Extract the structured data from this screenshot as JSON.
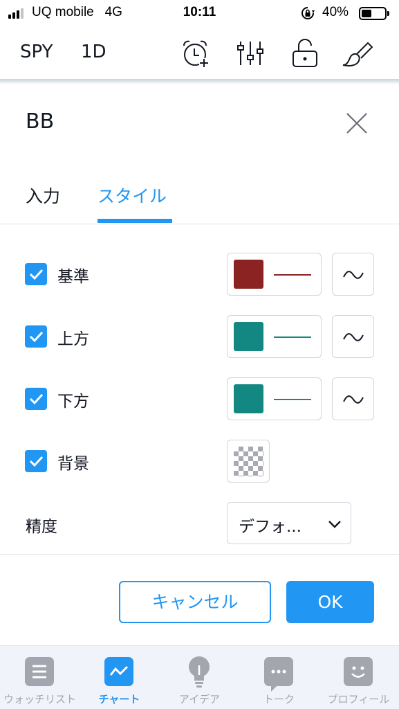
{
  "status_bar": {
    "carrier": "UQ mobile",
    "network": "4G",
    "time": "10:11",
    "battery": "40%"
  },
  "toolbar": {
    "symbol": "SPY",
    "interval": "1D"
  },
  "dialog": {
    "title": "BB",
    "tabs": [
      {
        "label": "入力",
        "active": false
      },
      {
        "label": "スタイル",
        "active": true
      }
    ],
    "rows": [
      {
        "label": "基準",
        "checked": true,
        "color": "#8b2323"
      },
      {
        "label": "上方",
        "checked": true,
        "color": "#138781"
      },
      {
        "label": "下方",
        "checked": true,
        "color": "#138781"
      },
      {
        "label": "背景",
        "checked": true
      }
    ],
    "precision": {
      "label": "精度",
      "value": "デフォ..."
    },
    "cancel_label": "キャンセル",
    "ok_label": "OK"
  },
  "bottom_nav": [
    {
      "label": "ウォッチリスト",
      "icon": "list-icon",
      "active": false
    },
    {
      "label": "チャート",
      "icon": "chart-icon",
      "active": true
    },
    {
      "label": "アイデア",
      "icon": "lightbulb-icon",
      "active": false
    },
    {
      "label": "トーク",
      "icon": "chat-bubble-icon",
      "active": false
    },
    {
      "label": "プロフィール",
      "icon": "smiley-icon",
      "active": false
    }
  ],
  "colors": {
    "accent": "#2196f3",
    "basis": "#8b2323",
    "bands": "#138781"
  }
}
